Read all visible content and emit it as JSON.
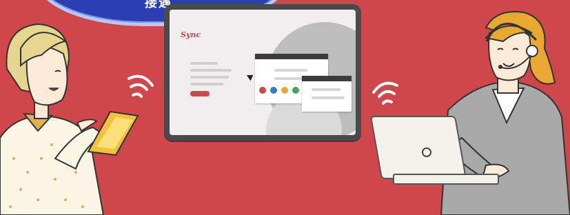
{
  "banner": {
    "text": "接遇"
  },
  "tablet": {
    "site_logo": "Sync",
    "dot_colors": [
      "#d0474b",
      "#3a78c2",
      "#e0a93a",
      "#4aa35a"
    ]
  },
  "colors": {
    "background": "#d0474b",
    "banner": "#2b3fb2",
    "device_frame": "#4a4a4a"
  }
}
